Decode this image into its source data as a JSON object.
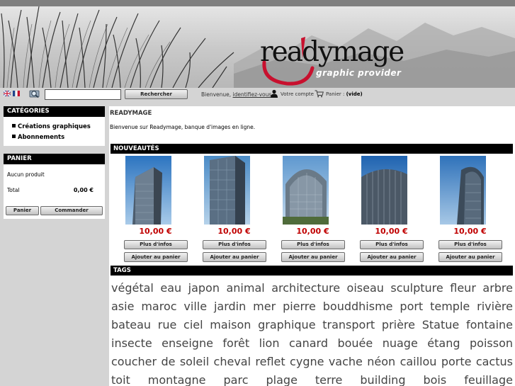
{
  "header": {
    "logo_text": "readymage",
    "logo_subtitle": "graphic provider"
  },
  "toolbar": {
    "flags": [
      "english-flag",
      "french-flag"
    ],
    "search": {
      "value": "",
      "placeholder": ""
    },
    "search_button": "Rechercher",
    "welcome_prefix": "Bienvenue, ",
    "login_link": "identifiez-vous",
    "account_label": "Votre compte",
    "cart_prefix": "Panier : ",
    "cart_status": "(vide)"
  },
  "categories": {
    "title": "CATÉGORIES",
    "items": [
      {
        "label": "Créations graphiques"
      },
      {
        "label": "Abonnements"
      }
    ]
  },
  "cart_box": {
    "title": "PANIER",
    "empty_text": "Aucun produit",
    "total_label": "Total",
    "total_value": "0,00 €",
    "panier_button": "Panier",
    "commander_button": "Commander"
  },
  "main": {
    "title": "READYMAGE",
    "welcome": "Bienvenue sur Readymage, banque d'images en ligne.",
    "new_section_title": "NOUVEAUTÉS",
    "products": [
      {
        "price": "10,00 €",
        "info_button": "Plus d'infos",
        "add_button": "Ajouter au panier",
        "sky": "#3f86c8"
      },
      {
        "price": "10,00 €",
        "info_button": "Plus d'infos",
        "add_button": "Ajouter au panier",
        "sky": "#5b95c9"
      },
      {
        "price": "10,00 €",
        "info_button": "Plus d'infos",
        "add_button": "Ajouter au panier",
        "sky": "#6a9fd0"
      },
      {
        "price": "10,00 €",
        "info_button": "Plus d'infos",
        "add_button": "Ajouter au panier",
        "sky": "#2e73bd"
      },
      {
        "price": "10,00 €",
        "info_button": "Plus d'infos",
        "add_button": "Ajouter au panier",
        "sky": "#3f7fc3"
      }
    ],
    "tags_title": "TAGS",
    "tags": [
      "végétal",
      "eau",
      "japon",
      "animal",
      "architecture",
      "oiseau",
      "sculpture",
      "fleur",
      "arbre",
      "asie",
      "maroc",
      "ville",
      "jardin",
      "mer",
      "pierre",
      "bouddhisme",
      "port",
      "temple",
      "rivière",
      "bateau",
      "rue",
      "ciel",
      "maison",
      "graphique",
      "transport",
      "prière",
      "Statue",
      "fontaine",
      "insecte",
      "enseigne",
      "forêt",
      "lion",
      "canard",
      "bouée",
      "nuage",
      "étang",
      "poisson",
      "coucher",
      "de",
      "soleil",
      "cheval",
      "reflet",
      "cygne",
      "vache",
      "néon",
      "caillou",
      "porte",
      "cactus",
      "toit",
      "montagne",
      "parc",
      "plage",
      "terre",
      "building",
      "bois",
      "feuillage"
    ]
  },
  "colors": {
    "price_red": "#c00000",
    "header_black": "#000000",
    "logo_red": "#c8102e"
  }
}
